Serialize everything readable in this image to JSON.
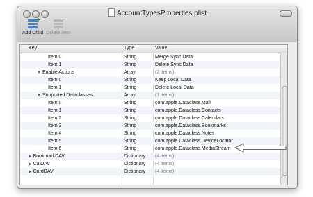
{
  "window": {
    "title": "AccountTypesProperties.plist"
  },
  "toolbar": {
    "add_child": "Add Child",
    "delete_item": "Delete Item"
  },
  "table": {
    "columns": [
      "Key",
      "Type",
      "Value"
    ],
    "rows": [
      {
        "key": "Item 0",
        "type": "String",
        "value": "Merge Sync Data"
      },
      {
        "key": "Item 1",
        "type": "String",
        "value": "Delete Sync Data"
      },
      {
        "key": "Enable Actions",
        "type": "Array",
        "value": "(2 items)"
      },
      {
        "key": "Item 0",
        "type": "String",
        "value": "Keep Local Data"
      },
      {
        "key": "Item 1",
        "type": "String",
        "value": "Delete Local Data"
      },
      {
        "key": "Supported Dataclasses",
        "type": "Array",
        "value": "(7 items)"
      },
      {
        "key": "Item 0",
        "type": "String",
        "value": "com.apple.Dataclass.Mail"
      },
      {
        "key": "Item 1",
        "type": "String",
        "value": "com.apple.Dataclass.Contacts"
      },
      {
        "key": "Item 2",
        "type": "String",
        "value": "com.apple.Dataclass.Calendars"
      },
      {
        "key": "Item 3",
        "type": "String",
        "value": "com.apple.Dataclass.Bookmarks"
      },
      {
        "key": "Item 4",
        "type": "String",
        "value": "com.apple.Dataclass.Notes"
      },
      {
        "key": "Item 5",
        "type": "String",
        "value": "com.apple.Dataclass.DeviceLocator"
      },
      {
        "key": "Item 6",
        "type": "String",
        "value": "com.apple.Dataclass.MediaStream"
      },
      {
        "key": "BookmarkDAV",
        "type": "Dictionary",
        "value": "(4 items)"
      },
      {
        "key": "CalDAV",
        "type": "Dictionary",
        "value": "(4 items)"
      },
      {
        "key": "CardDAV",
        "type": "Dictionary",
        "value": "(4 items)"
      }
    ]
  }
}
